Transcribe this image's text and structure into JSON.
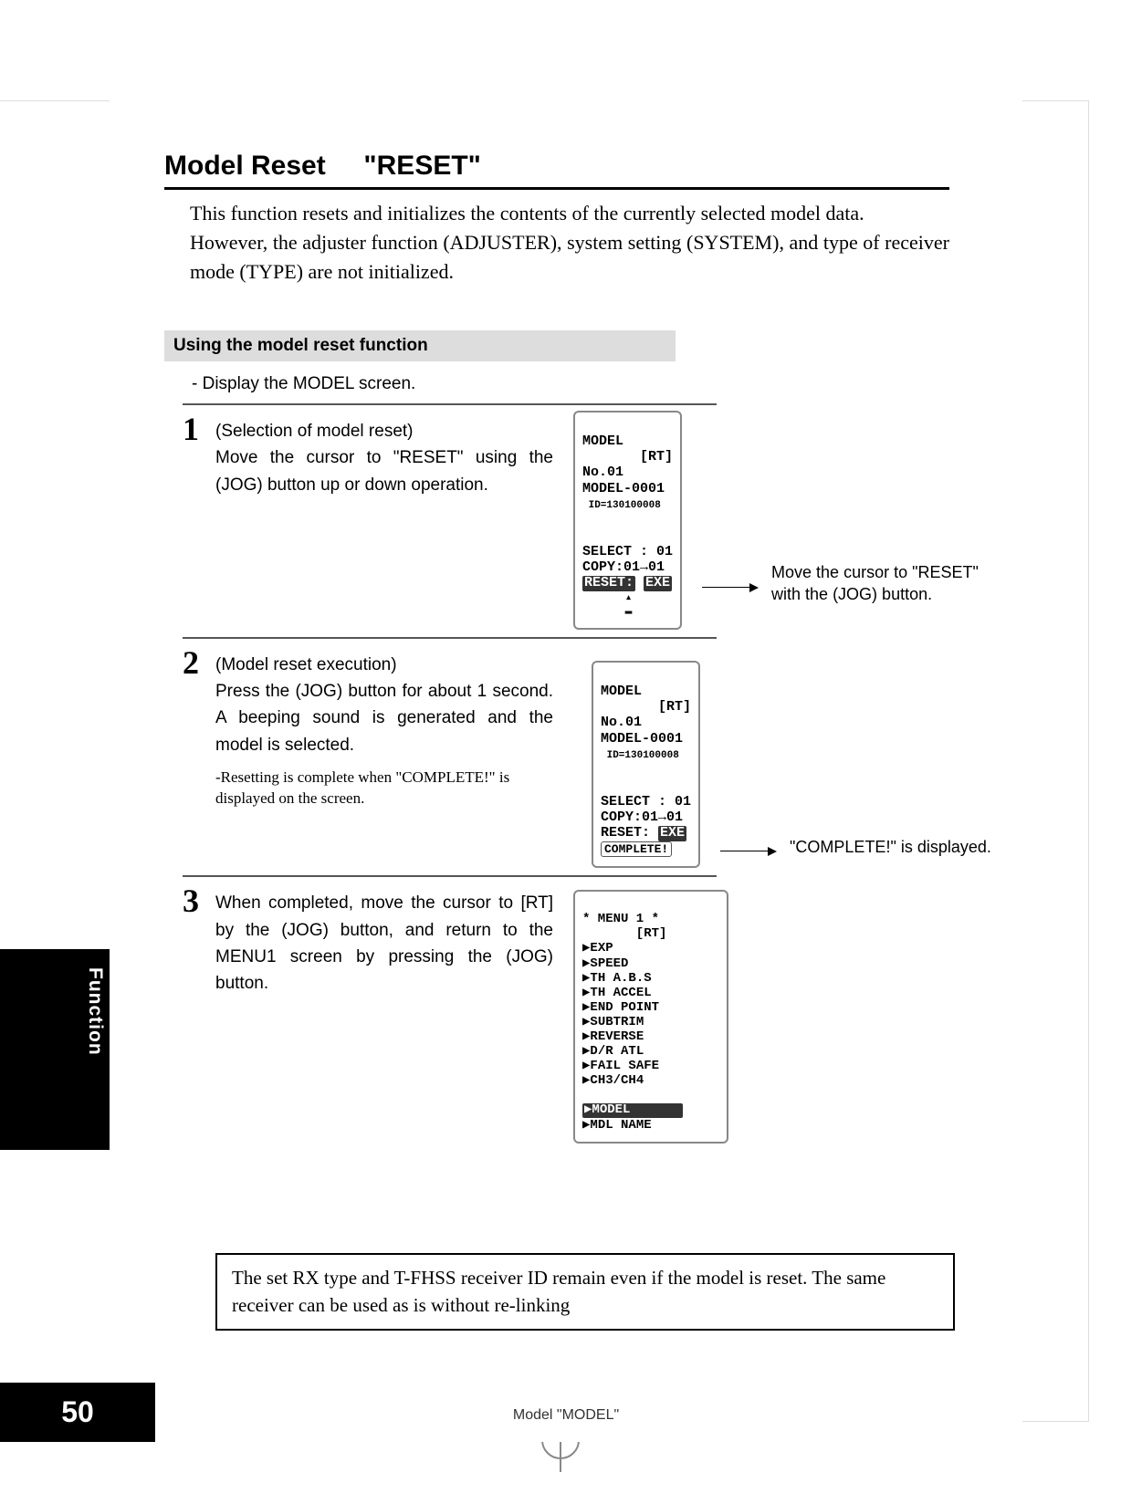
{
  "page": {
    "number": "50",
    "footer": "Model  \"MODEL\"",
    "side_tab": "Function"
  },
  "title": {
    "main": "Model Reset",
    "quoted_prefix": "\"",
    "reset": "RESET",
    "quoted_suffix": "\""
  },
  "intro": {
    "p1": "This function resets and initializes the contents of the currently selected model data.",
    "p2": "However, the adjuster function (ADJUSTER), system setting (SYSTEM), and type of receiver mode (TYPE) are not initialized."
  },
  "section": {
    "heading": "Using the model reset function",
    "display_line": "- Display the MODEL screen."
  },
  "steps": {
    "s1": {
      "num": "1",
      "heading": "(Selection of model reset)",
      "body": "Move the cursor to \"RESET\" using the (JOG) button up or down operation.",
      "callout": "Move the cursor to \"RESET\" with the (JOG) button."
    },
    "s2": {
      "num": "2",
      "heading": "(Model reset execution)",
      "body": "Press the (JOG) button for about 1 second. A beeping sound is generated and the model is selected.",
      "note": "-Resetting is complete when \"COMPLETE!\" is displayed on the screen.",
      "callout": "\"COMPLETE!\" is displayed."
    },
    "s3": {
      "num": "3",
      "body": "When completed, move the cursor to [RT] by the (JOG) button, and return to the MENU1 screen by pressing the (JOG) button."
    }
  },
  "lcd": {
    "screen1": {
      "l1": "MODEL",
      "l2": "       [RT]",
      "l3": "No.01",
      "l4": "MODEL-0001",
      "l5": " ID=130100008",
      "l6": "SELECT : 01",
      "l7": "COPY:01→01",
      "l8a": "RESET:",
      "l8b": "EXE"
    },
    "screen2": {
      "l1": "MODEL",
      "l2": "       [RT]",
      "l3": "No.01",
      "l4": "MODEL-0001",
      "l5": " ID=130100008",
      "l6": "SELECT : 01",
      "l7": "COPY:01→01",
      "l8a": "RESET:",
      "l8b": "EXE",
      "l9": "COMPLETE!"
    },
    "screen3": {
      "l1": "* MENU 1 *",
      "l2": "       [RT]",
      "items": [
        "▶EXP",
        "▶SPEED",
        "▶TH A.B.S",
        "▶TH ACCEL",
        "▶END POINT",
        "▶SUBTRIM",
        "▶REVERSE",
        "▶D/R ATL",
        "▶FAIL SAFE",
        "▶CH3/CH4"
      ],
      "sel": "▶MODEL",
      "last": "▶MDL NAME"
    }
  },
  "note_box": "The set RX type and T-FHSS receiver ID remain even if the model is reset. The same receiver can be used as is without re-linking"
}
